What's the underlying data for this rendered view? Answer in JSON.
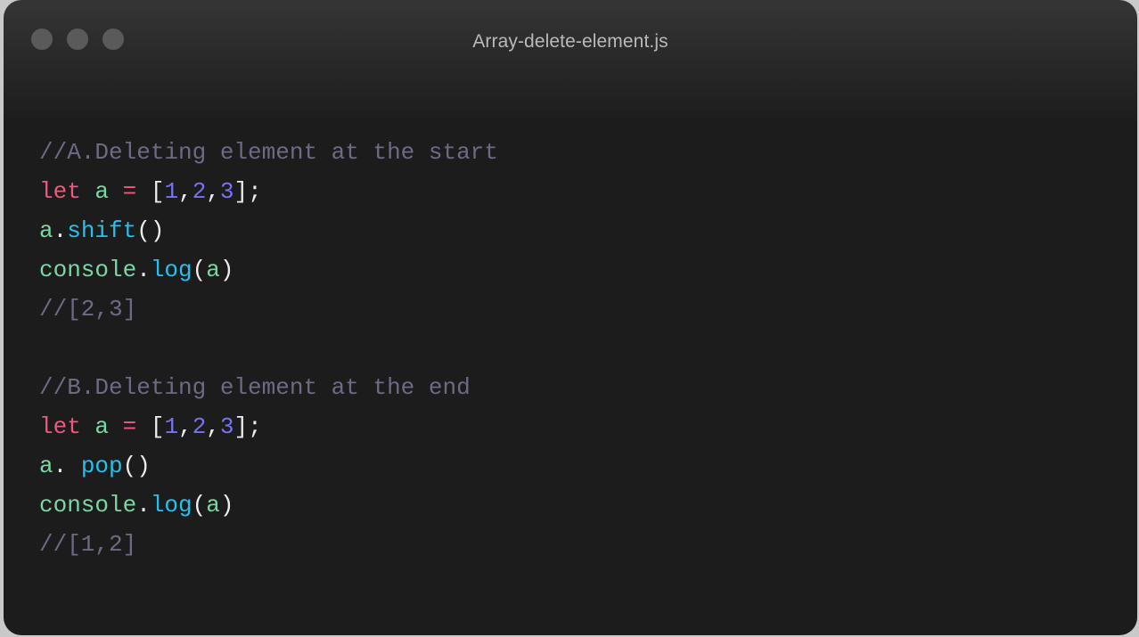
{
  "window": {
    "title": "Array-delete-element.js"
  },
  "colors": {
    "comment": "#6e6a86",
    "keyword": "#f3577d",
    "identifier": "#7ad7a2",
    "number": "#7772f0",
    "method": "#27c0ee",
    "punctuation": "#ececec"
  },
  "code": {
    "lines": [
      [
        {
          "t": "//A.Deleting element at the start",
          "k": "comment"
        }
      ],
      [
        {
          "t": "let",
          "k": "keyword"
        },
        {
          "t": " ",
          "k": "punct"
        },
        {
          "t": "a",
          "k": "ident"
        },
        {
          "t": " ",
          "k": "punct"
        },
        {
          "t": "=",
          "k": "op"
        },
        {
          "t": " [",
          "k": "punct"
        },
        {
          "t": "1",
          "k": "num"
        },
        {
          "t": ",",
          "k": "punct"
        },
        {
          "t": "2",
          "k": "num"
        },
        {
          "t": ",",
          "k": "punct"
        },
        {
          "t": "3",
          "k": "num"
        },
        {
          "t": "];",
          "k": "punct"
        }
      ],
      [
        {
          "t": "a",
          "k": "ident"
        },
        {
          "t": ".",
          "k": "punct"
        },
        {
          "t": "shift",
          "k": "method"
        },
        {
          "t": "()",
          "k": "punct"
        }
      ],
      [
        {
          "t": "console",
          "k": "ident"
        },
        {
          "t": ".",
          "k": "punct"
        },
        {
          "t": "log",
          "k": "method"
        },
        {
          "t": "(",
          "k": "punct"
        },
        {
          "t": "a",
          "k": "ident"
        },
        {
          "t": ")",
          "k": "punct"
        }
      ],
      [
        {
          "t": "//[2,3]",
          "k": "comment"
        }
      ],
      [],
      [
        {
          "t": "//B.Deleting element at the end",
          "k": "comment"
        }
      ],
      [
        {
          "t": "let",
          "k": "keyword"
        },
        {
          "t": " ",
          "k": "punct"
        },
        {
          "t": "a",
          "k": "ident"
        },
        {
          "t": " ",
          "k": "punct"
        },
        {
          "t": "=",
          "k": "op"
        },
        {
          "t": " [",
          "k": "punct"
        },
        {
          "t": "1",
          "k": "num"
        },
        {
          "t": ",",
          "k": "punct"
        },
        {
          "t": "2",
          "k": "num"
        },
        {
          "t": ",",
          "k": "punct"
        },
        {
          "t": "3",
          "k": "num"
        },
        {
          "t": "];",
          "k": "punct"
        }
      ],
      [
        {
          "t": "a",
          "k": "ident"
        },
        {
          "t": ". ",
          "k": "punct"
        },
        {
          "t": "pop",
          "k": "method"
        },
        {
          "t": "()",
          "k": "punct"
        }
      ],
      [
        {
          "t": "console",
          "k": "ident"
        },
        {
          "t": ".",
          "k": "punct"
        },
        {
          "t": "log",
          "k": "method"
        },
        {
          "t": "(",
          "k": "punct"
        },
        {
          "t": "a",
          "k": "ident"
        },
        {
          "t": ")",
          "k": "punct"
        }
      ],
      [
        {
          "t": "//[1,2]",
          "k": "comment"
        }
      ]
    ]
  }
}
